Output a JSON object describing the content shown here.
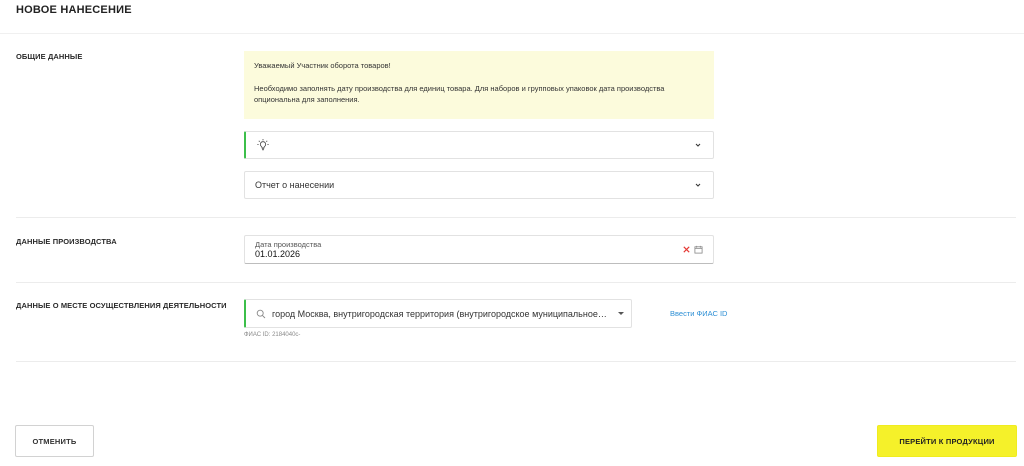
{
  "page": {
    "title": "НОВОЕ НАНЕСЕНИЕ"
  },
  "sections": {
    "general": {
      "label": "ОБЩИЕ ДАННЫЕ",
      "notice": {
        "line1": "Уважаемый Участник оборота товаров!",
        "line2": "Необходимо заполнять дату производства для единиц товара. Для наборов и групповых упаковок дата производства опциональна для заполнения."
      },
      "select_icon": "lightbulb-icon",
      "report_type": "Отчет о нанесении"
    },
    "production": {
      "label": "ДАННЫЕ ПРОИЗВОДСТВА",
      "date_label": "Дата производства",
      "date_value": "01.01.2026"
    },
    "location": {
      "label": "ДАННЫЕ О МЕСТЕ ОСУЩЕСТВЛЕНИЯ ДЕЯТЕЛЬНОСТИ",
      "address": "город Москва, внутригородская территория (внутригородское муниципальное образование)",
      "fias_link": "Ввести ФИАС ID",
      "fias_id": "ФИАС ID: 2184040c-"
    }
  },
  "actions": {
    "cancel_label": "ОТМЕНИТЬ",
    "next_label": "ПЕРЕЙТИ К ПРОДУКЦИИ"
  },
  "colors": {
    "accent_green": "#3cbf4a",
    "primary_button": "#f5f12a",
    "notice_bg": "#fcfbdc",
    "link": "#2d8fd5",
    "clear_icon": "#e53935"
  }
}
